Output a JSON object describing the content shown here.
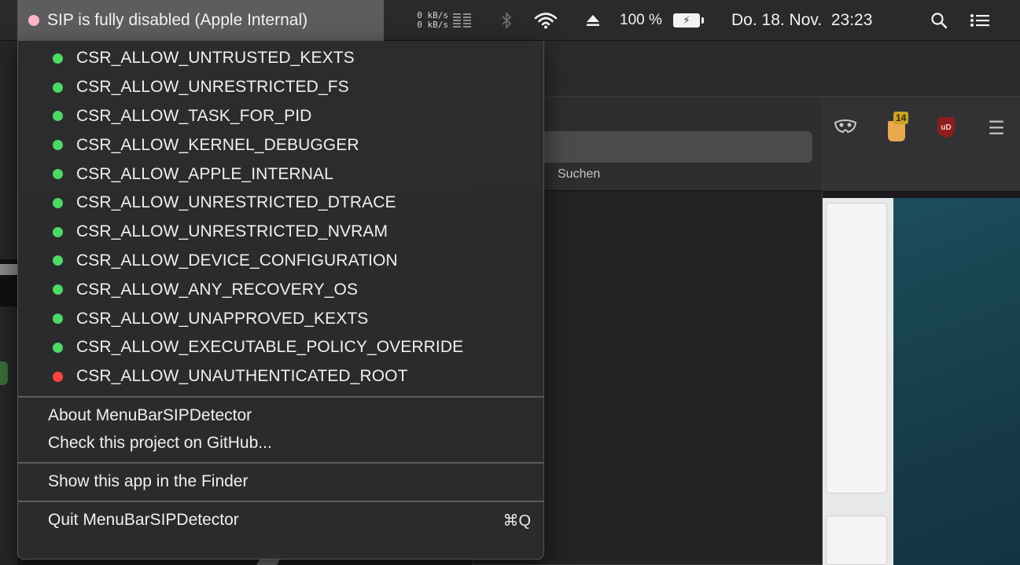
{
  "menubar": {
    "sip_status": "SIP is fully disabled (Apple Internal)",
    "sip_dot_color": "#ffb6c6",
    "net_up": "0 kB/s",
    "net_down": "0 kB/s",
    "battery_percent": "100 %",
    "battery_glyph": "⚡",
    "clock": "Do. 18. Nov.  23:23"
  },
  "menu": {
    "flags": [
      {
        "label": "CSR_ALLOW_UNTRUSTED_KEXTS",
        "status_color": "#4cd964"
      },
      {
        "label": "CSR_ALLOW_UNRESTRICTED_FS",
        "status_color": "#4cd964"
      },
      {
        "label": "CSR_ALLOW_TASK_FOR_PID",
        "status_color": "#4cd964"
      },
      {
        "label": "CSR_ALLOW_KERNEL_DEBUGGER",
        "status_color": "#4cd964"
      },
      {
        "label": "CSR_ALLOW_APPLE_INTERNAL",
        "status_color": "#4cd964"
      },
      {
        "label": "CSR_ALLOW_UNRESTRICTED_DTRACE",
        "status_color": "#4cd964"
      },
      {
        "label": "CSR_ALLOW_UNRESTRICTED_NVRAM",
        "status_color": "#4cd964"
      },
      {
        "label": "CSR_ALLOW_DEVICE_CONFIGURATION",
        "status_color": "#4cd964"
      },
      {
        "label": "CSR_ALLOW_ANY_RECOVERY_OS",
        "status_color": "#4cd964"
      },
      {
        "label": "CSR_ALLOW_UNAPPROVED_KEXTS",
        "status_color": "#4cd964"
      },
      {
        "label": "CSR_ALLOW_EXECUTABLE_POLICY_OVERRIDE",
        "status_color": "#4cd964"
      },
      {
        "label": "CSR_ALLOW_UNAUTHENTICATED_ROOT",
        "status_color": "#ff453a"
      }
    ],
    "about": "About MenuBarSIPDetector",
    "github": "Check this project on GitHub...",
    "show_in_finder": "Show this app in the Finder",
    "quit": "Quit MenuBarSIPDetector",
    "quit_shortcut": "⌘Q"
  },
  "background": {
    "search_label": "Suchen",
    "extension_badge": "14",
    "ublock_label": "uD"
  },
  "icons": {
    "net_bars": "net-activity-bars-icon",
    "bluetooth": "bluetooth-icon",
    "wifi": "wifi-icon",
    "eject": "eject-icon",
    "battery": "battery-charging-icon",
    "spotlight": "search-icon",
    "notification_center": "list-icon"
  }
}
